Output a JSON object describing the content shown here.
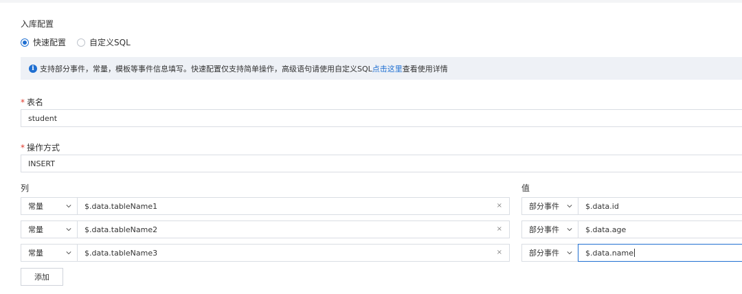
{
  "section_title": "入库配置",
  "mode": {
    "options": [
      {
        "label": "快速配置",
        "selected": true
      },
      {
        "label": "自定义SQL",
        "selected": false
      }
    ]
  },
  "info": {
    "text_before": "支持部分事件，常量，模板等事件信息填写。快速配置仅支持简单操作，高级语句请使用自定义SQL",
    "link": "点击这里",
    "text_after": "查看使用详情"
  },
  "table_name": {
    "label": "表名",
    "value": "student"
  },
  "operation": {
    "label": "操作方式",
    "value": "INSERT"
  },
  "columns_header": "列",
  "values_header": "值",
  "rows": [
    {
      "col_type": "常量",
      "col_value": "$.data.tableName1",
      "val_type": "部分事件",
      "val_value": "$.data.id"
    },
    {
      "col_type": "常量",
      "col_value": "$.data.tableName2",
      "val_type": "部分事件",
      "val_value": "$.data.age"
    },
    {
      "col_type": "常量",
      "col_value": "$.data.tableName3",
      "val_type": "部分事件",
      "val_value": "$.data.name"
    }
  ],
  "add_label": "添加",
  "clear_glyph": "×",
  "colors": {
    "accent": "#1f6fd1",
    "required": "#e0392b",
    "info_bg": "#eef1f6"
  }
}
